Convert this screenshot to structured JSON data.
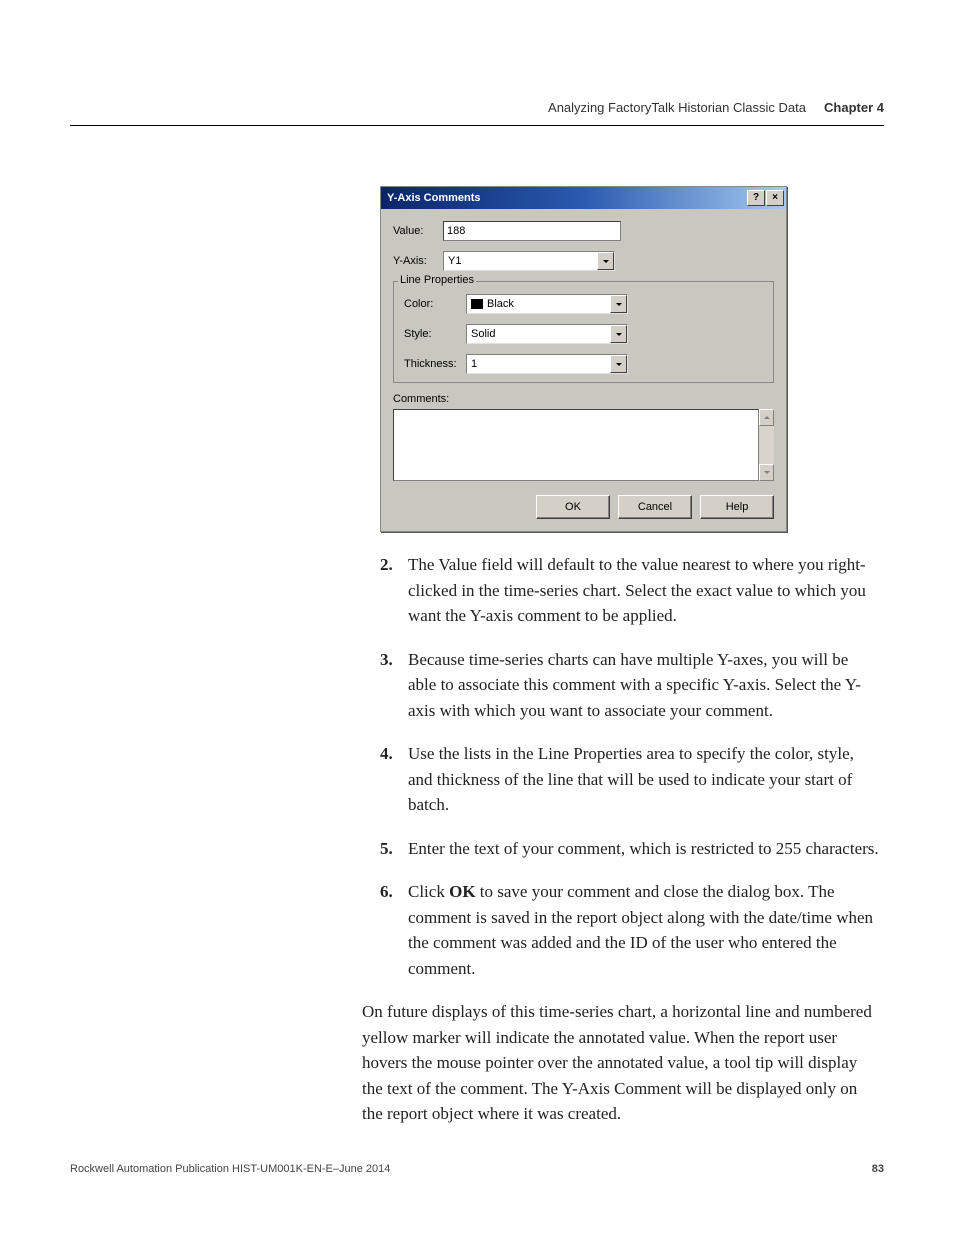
{
  "header": {
    "section": "Analyzing FactoryTalk Historian Classic Data",
    "chapter": "Chapter 4"
  },
  "dialog": {
    "title": "Y-Axis Comments",
    "help_btn": "?",
    "close_btn": "×",
    "value_label": "Value:",
    "value_input": "188",
    "yaxis_label": "Y-Axis:",
    "yaxis_value": "Y1",
    "fieldset_legend": "Line Properties",
    "color_label": "Color:",
    "color_value": "Black",
    "style_label": "Style:",
    "style_value": "Solid",
    "thickness_label": "Thickness:",
    "thickness_value": "1",
    "comments_label": "Comments:",
    "ok": "OK",
    "cancel": "Cancel",
    "help": "Help"
  },
  "steps": {
    "s2_num": "2.",
    "s2": "The Value field will default to the value nearest to where you right-clicked in the time-series chart. Select the exact value to which you want the Y-axis comment to be applied.",
    "s3_num": "3.",
    "s3": "Because time-series charts can have multiple Y-axes, you will be able to associate this comment with a specific Y-axis. Select the Y-axis with which you want to associate your comment.",
    "s4_num": "4.",
    "s4": "Use the lists in the Line Properties area to specify the color, style, and thickness of the line that will be used to indicate your start of batch.",
    "s5_num": "5.",
    "s5": "Enter the text of your comment, which is restricted to 255 characters.",
    "s6_num": "6.",
    "s6_a": "Click ",
    "s6_ok": "OK",
    "s6_b": " to save your comment and close the dialog box. The comment is saved in the report object along with the date/time when the comment was added and the ID of the user who entered the comment."
  },
  "paragraph": "On future displays of this time-series chart, a horizontal line and numbered yellow marker will indicate the annotated value. When the report user hovers the mouse pointer over the annotated value, a tool tip will display the text of the comment. The Y-Axis Comment will be displayed only on the report object where it was created.",
  "footer": {
    "pub": "Rockwell Automation Publication HIST-UM001K-EN-E–June 2014",
    "page": "83"
  }
}
